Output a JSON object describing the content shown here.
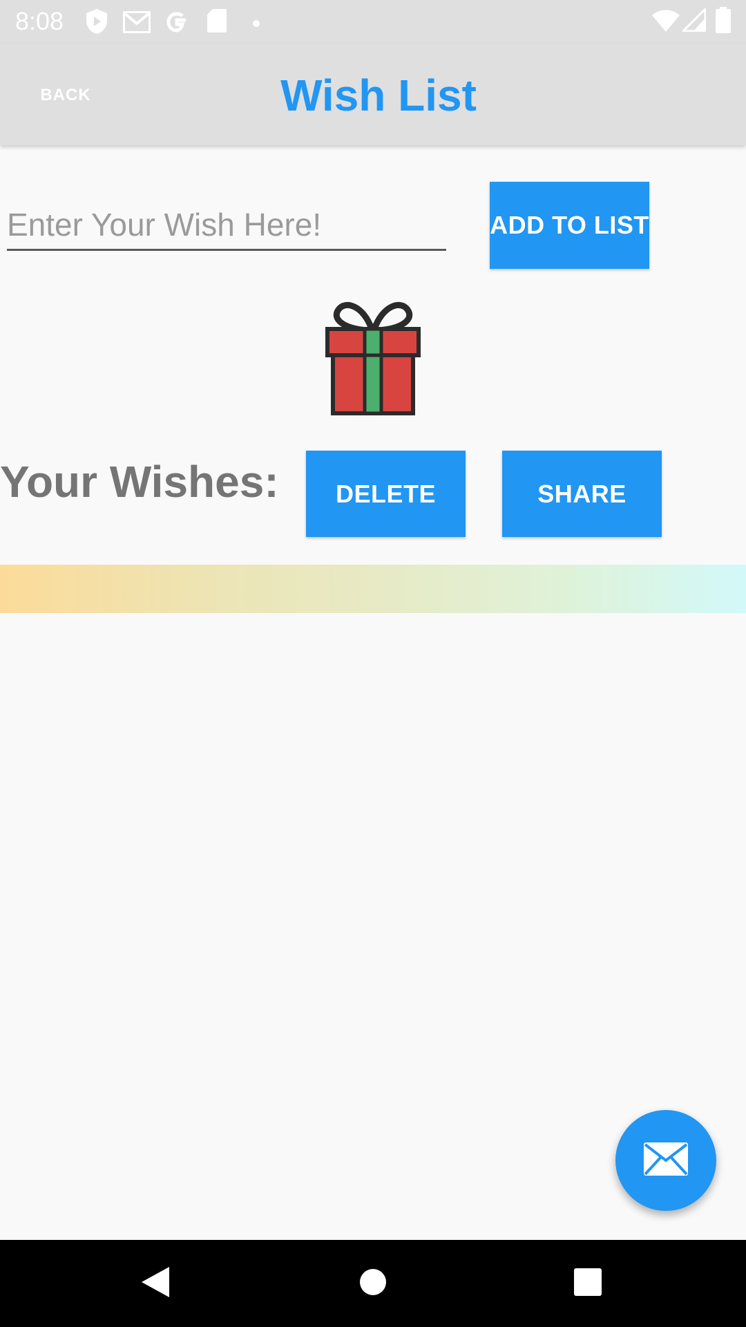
{
  "status_bar": {
    "time": "8:08",
    "icons": [
      "shield-icon",
      "gmail-icon",
      "google-icon",
      "sd-card-icon",
      "dot-icon",
      "wifi-icon",
      "signal-icon",
      "battery-icon"
    ]
  },
  "app_bar": {
    "back_label": "BACK",
    "title": "Wish List"
  },
  "wish_input": {
    "placeholder": "Enter Your Wish Here!",
    "value": ""
  },
  "buttons": {
    "add_label": "ADD TO LIST",
    "delete_label": "DELETE",
    "share_label": "SHARE"
  },
  "wishes_section": {
    "label": "Your Wishes:",
    "items": []
  },
  "fab": {
    "icon": "mail-icon"
  },
  "nav_bar": {
    "icons": [
      "back-icon",
      "home-icon",
      "recents-icon"
    ]
  },
  "colors": {
    "accent": "#2196f3",
    "app_bar_bg": "#dfdfdf",
    "label_gray": "#757575",
    "background": "#f9f9f9",
    "gift_red": "#d84541",
    "gift_green": "#4caf6e"
  }
}
